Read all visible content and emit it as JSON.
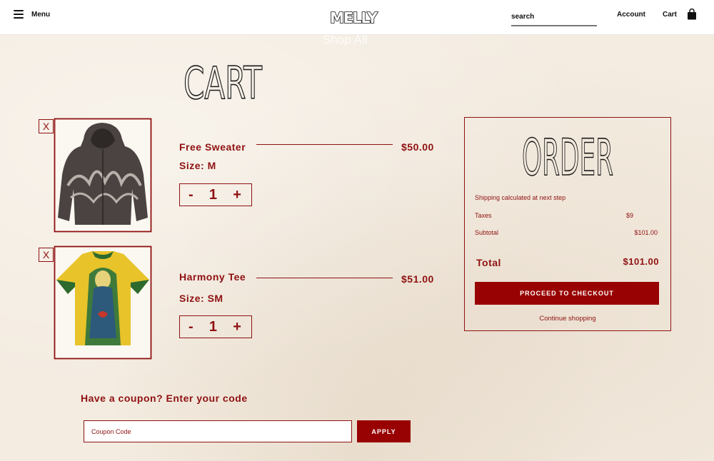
{
  "header": {
    "menu_label": "Menu",
    "logo_text": "MELLY",
    "search_placeholder": "search",
    "account_label": "Account",
    "cart_label": "Cart",
    "shop_all_label": "Shop All"
  },
  "cart": {
    "title": "CART",
    "remove_label": "X",
    "items": [
      {
        "name": "Free Sweater",
        "size": "Size: M",
        "price": "$50.00",
        "quantity": "1",
        "image": "hoodie-graphic"
      },
      {
        "name": "Harmony Tee",
        "size": "Size: SM",
        "price": "$51.00",
        "quantity": "1",
        "image": "madonna-jersey-tee"
      }
    ],
    "minus_label": "-",
    "plus_label": "+"
  },
  "order": {
    "title": "ORDER",
    "shipping_note": "Shipping calculated at next step",
    "taxes_label": "Taxes",
    "taxes_value": "$9",
    "subtotal_label": "Subtotal",
    "subtotal_value": "$101.00",
    "total_label": "Total",
    "total_value": "$101.00",
    "checkout_label": "PROCEED TO CHECKOUT",
    "continue_label": "Continue shopping"
  },
  "coupon": {
    "heading": "Have a coupon? Enter your code",
    "placeholder": "Coupon Code",
    "apply_label": "APPLY"
  },
  "colors": {
    "accent": "#990202",
    "text": "#8f1111",
    "paper": "#f4ece1"
  }
}
